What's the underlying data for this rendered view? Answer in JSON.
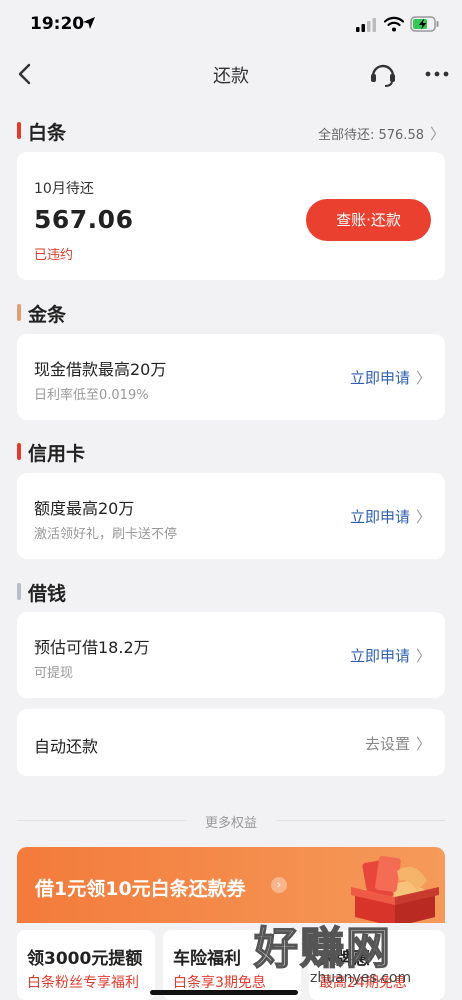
{
  "status_bar": {
    "time": "19:20"
  },
  "nav": {
    "title": "还款"
  },
  "baitiao": {
    "section_title": "白条",
    "total_label": "全部待还: 576.58",
    "month_label": "10月待还",
    "amount": "567.06",
    "status": "已违约",
    "pay_button": "查账·还款"
  },
  "jintiao": {
    "section_title": "金条",
    "title": "现金借款最高20万",
    "subtitle": "日利率低至0.019%",
    "link": "立即申请"
  },
  "credit_card": {
    "section_title": "信用卡",
    "title": "额度最高20万",
    "subtitle": "激活领好礼，刷卡送不停",
    "link": "立即申请"
  },
  "borrow": {
    "section_title": "借钱",
    "title": "预估可借18.2万",
    "subtitle": "可提现",
    "link": "立即申请"
  },
  "auto_repay": {
    "title": "自动还款",
    "link": "去设置"
  },
  "more_benefits": {
    "label": "更多权益"
  },
  "promo": {
    "text": "借1元领10元白条还款券"
  },
  "benefits": [
    {
      "title": "领3000元提额",
      "subtitle": "白条粉丝专享福利"
    },
    {
      "title": "车险福利",
      "subtitle": "白条享3期免息"
    },
    {
      "title": "大牌惠",
      "subtitle": "最高24期免息"
    }
  ],
  "watermark": {
    "main": "好赚网",
    "sub": "zhuanyes.com"
  },
  "colors": {
    "accent_red": "#e9402f",
    "link_blue": "#2f5fb3",
    "baitiao_bar": "#e23b2e",
    "jintiao_bar": "#d9a07a",
    "credit_bar": "#e23b2e",
    "borrow_bar": "#b8bcc8"
  }
}
